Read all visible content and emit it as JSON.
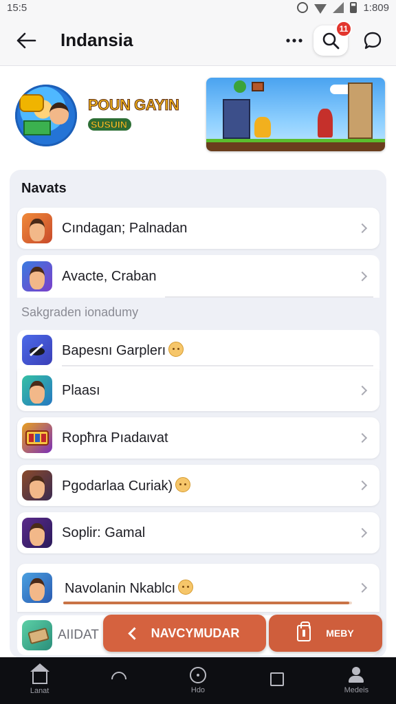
{
  "status_bar": {
    "time": "15:5",
    "clock": "1:809"
  },
  "header": {
    "title": "Indansia",
    "badge_count": "11"
  },
  "promo": {
    "title": "POUN GAYIN",
    "subtitle": "SUSUIN"
  },
  "section": {
    "title": "Navats"
  },
  "items": [
    {
      "label": "Cındagan; Palnadan"
    },
    {
      "label": "Avacte, Craban"
    },
    {
      "label": "Bapesnı Garplerı"
    },
    {
      "label": "Plaası"
    },
    {
      "label": "Ropħra Pıadaιvat"
    },
    {
      "label": "Pgodarlaa Curiak)"
    },
    {
      "label": "Soplir: Gamal"
    },
    {
      "label": "Navolanin Nkablcı"
    }
  ],
  "subheader": "Sakgraden ionadumy",
  "tray": {
    "label": "AIIDAT"
  },
  "buttons": {
    "primary": "NAVCYMUDAR",
    "secondary": "MEBY"
  },
  "progress": {
    "fraction": 0.99
  },
  "bottom_nav": [
    {
      "label": "Lanat",
      "icon": "home-icon"
    },
    {
      "label": "",
      "icon": "back-icon"
    },
    {
      "label": "Hdo",
      "icon": "circle-icon"
    },
    {
      "label": "",
      "icon": "square-icon"
    },
    {
      "label": "Medeis",
      "icon": "person-icon"
    }
  ],
  "colors": {
    "accent": "#d5623f",
    "badge": "#e2362e",
    "panel": "#eef0f6",
    "nav_bg": "#0d0e12"
  }
}
